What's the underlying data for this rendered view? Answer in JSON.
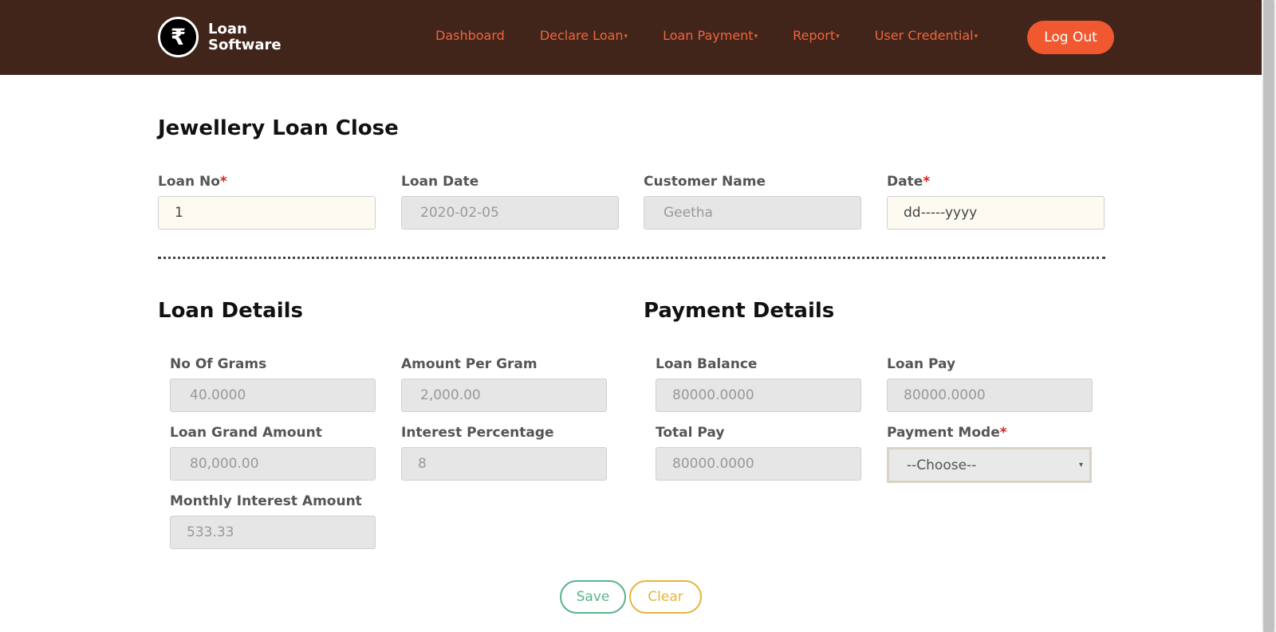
{
  "brand": {
    "symbol": "₹",
    "line1": "Loan",
    "line2": "Software",
    "icon": "rupee-icon"
  },
  "nav": {
    "dashboard": "Dashboard",
    "declare_loan": "Declare Loan",
    "loan_payment": "Loan Payment",
    "report": "Report",
    "user_credential": "User Credential",
    "caret": "▾",
    "logout": "Log Out"
  },
  "page": {
    "title": "Jewellery Loan Close"
  },
  "top_form": {
    "loan_no": {
      "label": "Loan No",
      "required": "*",
      "value": "1"
    },
    "loan_date": {
      "label": "Loan Date",
      "value": "2020-02-05"
    },
    "customer_name": {
      "label": "Customer Name",
      "value": "Geetha"
    },
    "date": {
      "label": "Date",
      "required": "*",
      "value": "dd-----yyyy"
    }
  },
  "loan_details": {
    "title": "Loan Details",
    "no_of_grams": {
      "label": "No Of Grams",
      "value": "40.0000"
    },
    "amount_per_gram": {
      "label": "Amount Per Gram",
      "value": "2,000.00"
    },
    "loan_grand_amount": {
      "label": "Loan Grand Amount",
      "value": "80,000.00"
    },
    "interest_percentage": {
      "label": "Interest Percentage",
      "value": "8"
    },
    "monthly_interest_amount": {
      "label": "Monthly Interest Amount",
      "value": "533.33"
    }
  },
  "payment_details": {
    "title": "Payment Details",
    "loan_balance": {
      "label": "Loan Balance",
      "value": "80000.0000"
    },
    "loan_pay": {
      "label": "Loan Pay",
      "value": "80000.0000"
    },
    "total_pay": {
      "label": "Total Pay",
      "value": "80000.0000"
    },
    "payment_mode": {
      "label": "Payment Mode",
      "required": "*",
      "value": "--Choose--",
      "arrow": "▾"
    }
  },
  "actions": {
    "save": "Save",
    "clear": "Clear"
  },
  "colors": {
    "header_bg": "#41251b",
    "nav_text": "#f0643a",
    "logout_bg": "#f0582f",
    "save": "#5ab38a",
    "clear": "#e5b63e",
    "required": "#e02020"
  }
}
